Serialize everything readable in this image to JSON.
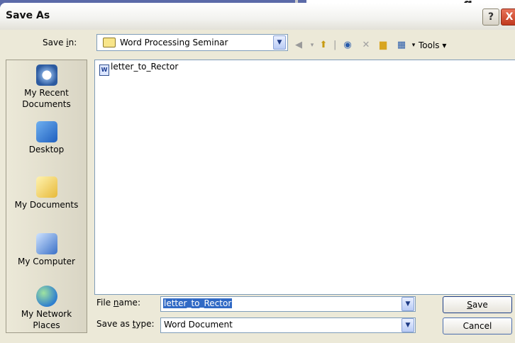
{
  "window": {
    "title": "Save As",
    "help_glyph": "?",
    "close_glyph": "X"
  },
  "background": {
    "glyph": "g"
  },
  "save_in": {
    "label_prefix": "Save ",
    "label_key": "i",
    "label_suffix": "n:",
    "value": "Word Processing Seminar"
  },
  "toolbar": {
    "tools_label": "Tools"
  },
  "places": [
    {
      "label_line1": "My Recent",
      "label_line2": "Documents",
      "icon": "recent-documents-icon"
    },
    {
      "label_line1": "Desktop",
      "label_line2": "",
      "icon": "desktop-icon"
    },
    {
      "label_line1": "My Documents",
      "label_line2": "",
      "icon": "my-documents-icon"
    },
    {
      "label_line1": "My Computer",
      "label_line2": "",
      "icon": "my-computer-icon"
    },
    {
      "label_line1": "My Network",
      "label_line2": "Places",
      "icon": "network-places-icon"
    }
  ],
  "files": [
    {
      "name": "letter_to_Rector",
      "icon": "word-document-icon"
    }
  ],
  "file_name": {
    "label_prefix": "File ",
    "label_key": "n",
    "label_suffix": "ame:",
    "value": "letter_to_Rector"
  },
  "save_as_type": {
    "label_prefix": "Save as ",
    "label_key": "t",
    "label_suffix": "ype:",
    "value": "Word Document"
  },
  "buttons": {
    "save_key": "S",
    "save_rest": "ave",
    "cancel": "Cancel"
  }
}
